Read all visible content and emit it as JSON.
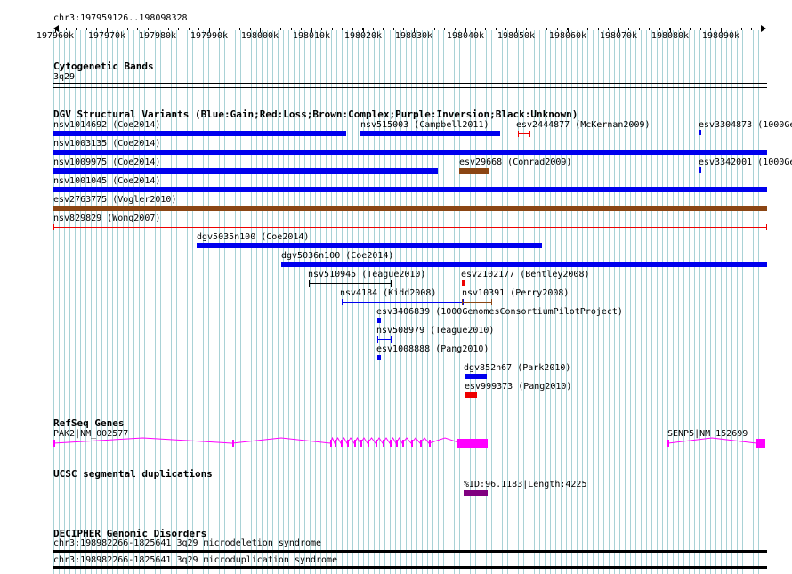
{
  "ruler": {
    "title": "chr3:197959126..198098328",
    "ticks": [
      "197960k",
      "197970k",
      "197980k",
      "197990k",
      "198000k",
      "198010k",
      "198020k",
      "198030k",
      "198040k",
      "198050k",
      "198060k",
      "198070k",
      "198080k",
      "198090k"
    ]
  },
  "colors": {
    "gain": "#0000ee",
    "loss": "#ee0000",
    "complex": "#8b4513",
    "inversion": "#800080",
    "unknown": "#000000",
    "gene": "#ff00ff",
    "segdup": "#800080",
    "grid": "#a9d2d6"
  },
  "tracks": {
    "cytobands": {
      "title": "Cytogenetic Bands",
      "band_label": "3q29"
    },
    "dgv": {
      "title": "DGV Structural Variants (Blue:Gain;Red:Loss;Brown:Complex;Purple:Inversion;Black:Unknown)",
      "features": [
        {
          "label": "nsv1014692 (Coe2014)",
          "type": "gain"
        },
        {
          "label": "nsv515003 (Campbell2011)",
          "type": "gain"
        },
        {
          "label": "esv2444877 (McKernan2009)",
          "type": "loss"
        },
        {
          "label": "esv3304873 (1000Ge",
          "type": "gain"
        },
        {
          "label": "nsv1003135 (Coe2014)",
          "type": "gain"
        },
        {
          "label": "nsv1009975 (Coe2014)",
          "type": "gain"
        },
        {
          "label": "esv29668 (Conrad2009)",
          "type": "complex"
        },
        {
          "label": "esv3342001 (1000Ge",
          "type": "gain"
        },
        {
          "label": "nsv1001045 (Coe2014)",
          "type": "gain"
        },
        {
          "label": "esv2763775 (Vogler2010)",
          "type": "complex"
        },
        {
          "label": "nsv829829 (Wong2007)",
          "type": "loss"
        },
        {
          "label": "dgv5035n100 (Coe2014)",
          "type": "gain"
        },
        {
          "label": "dgv5036n100 (Coe2014)",
          "type": "gain"
        },
        {
          "label": "nsv510945 (Teague2010)",
          "type": "unknown"
        },
        {
          "label": "esv2102177 (Bentley2008)",
          "type": "loss"
        },
        {
          "label": "nsv4184 (Kidd2008)",
          "type": "gain"
        },
        {
          "label": "nsv10391 (Perry2008)",
          "type": "complex"
        },
        {
          "label": "esv3406839 (1000GenomesConsortiumPilotProject)",
          "type": "gain"
        },
        {
          "label": "nsv508979 (Teague2010)",
          "type": "gain"
        },
        {
          "label": "esv1008888 (Pang2010)",
          "type": "gain"
        },
        {
          "label": "dgv852n67 (Park2010)",
          "type": "gain"
        },
        {
          "label": "esv999373 (Pang2010)",
          "type": "loss"
        }
      ]
    },
    "refseq": {
      "title": "RefSeq Genes",
      "genes": [
        {
          "label": "PAK2|NM_002577"
        },
        {
          "label": "SENP5|NM_152699"
        }
      ]
    },
    "segdup": {
      "title": "UCSC segmental duplications",
      "label": "%ID:96.1183|Length:4225"
    },
    "decipher": {
      "title": "DECIPHER Genomic Disorders",
      "items": [
        {
          "label": "chr3:198982266-1825641|3q29 microdeletion syndrome"
        },
        {
          "label": "chr3:198982266-1825641|3q29 microduplication syndrome"
        }
      ]
    }
  }
}
